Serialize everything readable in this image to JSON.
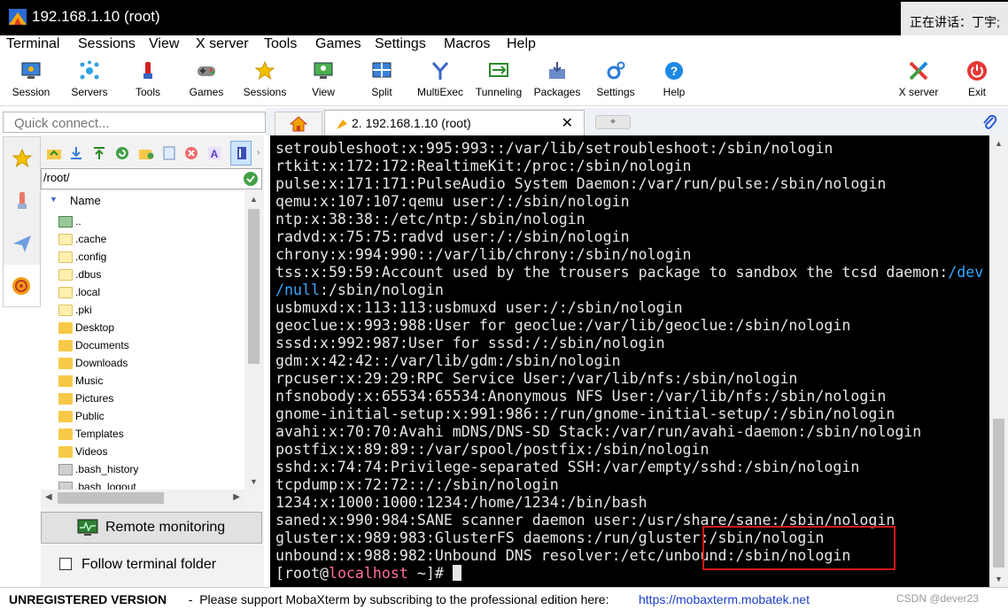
{
  "window": {
    "title": "192.168.1.10 (root)",
    "speaking_text": "正在讲话：丁宇;"
  },
  "menu": [
    "Terminal",
    "Sessions",
    "View",
    "X server",
    "Tools",
    "Games",
    "Settings",
    "Macros",
    "Help"
  ],
  "toolbar": [
    "Session",
    "Servers",
    "Tools",
    "Games",
    "Sessions",
    "View",
    "Split",
    "MultiExec",
    "Tunneling",
    "Packages",
    "Settings",
    "Help",
    "X server",
    "Exit"
  ],
  "quick_connect": {
    "placeholder": "Quick connect..."
  },
  "tabs": {
    "active_label": "2. 192.168.1.10 (root)"
  },
  "sidebar": {
    "path": "/root/",
    "column_header": "Name",
    "files": [
      "..",
      ".cache",
      ".config",
      ".dbus",
      ".local",
      ".pki",
      "Desktop",
      "Documents",
      "Downloads",
      "Music",
      "Pictures",
      "Public",
      "Templates",
      "Videos",
      ".bash_history",
      ".bash_logout"
    ],
    "remote_monitoring": "Remote monitoring",
    "follow_terminal": "Follow terminal folder"
  },
  "terminal": {
    "lines": [
      "setroubleshoot:x:995:993::/var/lib/setroubleshoot:/sbin/nologin",
      "rtkit:x:172:172:RealtimeKit:/proc:/sbin/nologin",
      "pulse:x:171:171:PulseAudio System Daemon:/var/run/pulse:/sbin/nologin",
      "qemu:x:107:107:qemu user:/:/sbin/nologin",
      "ntp:x:38:38::/etc/ntp:/sbin/nologin",
      "radvd:x:75:75:radvd user:/:/sbin/nologin",
      "chrony:x:994:990::/var/lib/chrony:/sbin/nologin",
      "tss:x:59:59:Account used by the trousers package to sandbox the tcsd daemon:",
      ":/sbin/nologin",
      "usbmuxd:x:113:113:usbmuxd user:/:/sbin/nologin",
      "geoclue:x:993:988:User for geoclue:/var/lib/geoclue:/sbin/nologin",
      "sssd:x:992:987:User for sssd:/:/sbin/nologin",
      "gdm:x:42:42::/var/lib/gdm:/sbin/nologin",
      "rpcuser:x:29:29:RPC Service User:/var/lib/nfs:/sbin/nologin",
      "nfsnobody:x:65534:65534:Anonymous NFS User:/var/lib/nfs:/sbin/nologin",
      "gnome-initial-setup:x:991:986::/run/gnome-initial-setup/:/sbin/nologin",
      "avahi:x:70:70:Avahi mDNS/DNS-SD Stack:/var/run/avahi-daemon:/sbin/nologin",
      "postfix:x:89:89::/var/spool/postfix:/sbin/nologin",
      "sshd:x:74:74:Privilege-separated SSH:/var/empty/sshd:/sbin/nologin",
      "tcpdump:x:72:72::/:/sbin/nologin",
      "1234:x:1000:1000:1234:/home/1234:/bin/bash",
      "saned:x:990:984:SANE scanner daemon user:/usr/share/sane:/sbin/nologin",
      "gluster:x:989:983:GlusterFS daemons:/run/gluster:/sbin/nologin",
      "unbound:x:988:982:Unbound DNS resolver:/etc/unbound:/sbin/nologin"
    ],
    "tss_cyan_1": "/dev",
    "tss_cyan_2": "/null",
    "prompt_open": "[root@",
    "prompt_host": "localhost",
    "prompt_close": " ~]# "
  },
  "status": {
    "unregistered": "UNREGISTERED VERSION",
    "message": "  -  Please support MobaXterm by subscribing to the professional edition here:  ",
    "link": "https://mobaxterm.mobatek.net",
    "watermark": "CSDN @dever23"
  },
  "colors": {
    "highlight": "#d0181a",
    "cyan": "#33a8ff",
    "prompt_host": "#ff6fa3"
  }
}
